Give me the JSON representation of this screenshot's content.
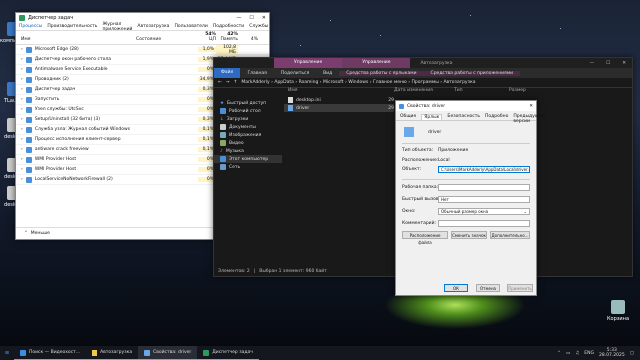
{
  "desktop": {
    "icons": [
      {
        "label": "Корзина"
      },
      {
        "label": "desktop"
      },
      {
        "label": "desktop"
      },
      {
        "label": "desktop"
      },
      {
        "label": "компьютер"
      },
      {
        "label": "TLaun..."
      }
    ]
  },
  "task_manager": {
    "title": "Диспетчер задач",
    "menu": [
      "Процессы",
      "Производительность",
      "Журнал приложений",
      "Автозагрузка",
      "Пользователи",
      "Подробности",
      "Службы"
    ],
    "headers": {
      "name": "Имя",
      "status": "Состояние",
      "cpu_pct": "54%",
      "cpu": "ЦП",
      "mem_pct": "42%",
      "mem": "Память",
      "disk_pct": "4%"
    },
    "rows": [
      {
        "name": "Microsoft Edge (28)",
        "cpu": "1,0%",
        "mem": "102,8 МБ"
      },
      {
        "name": "Диспетчер окон рабочего стола",
        "cpu": "1,9%",
        "mem": "57,4 МБ"
      },
      {
        "name": "Antimalware Service Executable",
        "cpu": "0%",
        "mem": "34,3 МБ"
      },
      {
        "name": "Проводник (2)",
        "cpu": "34,9%",
        "mem": "29,6 МБ"
      },
      {
        "name": "Диспетчер задач",
        "cpu": "0,3%",
        "mem": "27,6 МБ"
      },
      {
        "name": "Запустить",
        "cpu": "0%",
        "mem": "24,5 МБ"
      },
      {
        "name": "Узел службы: UtcSvc",
        "cpu": "0%",
        "mem": "17,1 МБ"
      },
      {
        "name": "Setup/Uninstall (32 бита) (3)",
        "cpu": "0,3%",
        "mem": "15,5 МБ"
      },
      {
        "name": "Служба узла: Журнал событий Windows",
        "cpu": "0,1%",
        "mem": "14,6 МБ"
      },
      {
        "name": "Процесс исполнения клиент-сервер",
        "cpu": "0,1%",
        "mem": "12,6 МБ"
      },
      {
        "name": "antiware crack freeview",
        "cpu": "0,1%",
        "mem": "11,3 МБ"
      },
      {
        "name": "WMI Provider Host",
        "cpu": "0%",
        "mem": "9,0 МБ"
      },
      {
        "name": "WMI Provider Host",
        "cpu": "0%",
        "mem": "8,3 МБ"
      },
      {
        "name": "LocalServiceNoNetworkFirewall (2)",
        "cpu": "0%",
        "mem": "7,8 МБ"
      }
    ],
    "footer": "Меньше"
  },
  "explorer": {
    "tabs": [
      "Управление",
      "Управление",
      "Автозагрузка"
    ],
    "ribbon": [
      "Файл",
      "Главная",
      "Поделиться",
      "Вид",
      "Средства работы с ярлыками",
      "Средства работы с приложениями"
    ],
    "path": [
      "MarkAdderly",
      "AppData",
      "Roaming",
      "Microsoft",
      "Windows",
      "Главное меню",
      "Программы",
      "Автозагрузка"
    ],
    "columns": {
      "name": "Имя",
      "date": "Дата изменения",
      "type": "Тип",
      "size": "Размер"
    },
    "nav": [
      "Быстрый доступ",
      "Рабочий стол",
      "Загрузки",
      "Документы",
      "Изображения",
      "Видео",
      "Музыка",
      "Этот компьютер",
      "Сеть"
    ],
    "files": [
      {
        "name": "desktop.ini",
        "date": "29"
      },
      {
        "name": "driver",
        "date": "29"
      }
    ],
    "status": {
      "count": "Элементов: 2",
      "selected": "Выбран 1 элемент: 960 байт"
    }
  },
  "dialog": {
    "title": "Свойства: driver",
    "tabs": [
      "Общие",
      "Ярлык",
      "Безопасность",
      "Подробно",
      "Предыдущие версии"
    ],
    "name": "driver",
    "target_type_label": "Тип объекта:",
    "target_type": "Приложение",
    "location_label": "Расположение:",
    "location": "Local",
    "target_label": "Объект:",
    "target": "C:\\Users\\MarkAdderly\\AppData\\Local\\driver.exe",
    "workdir_label": "Рабочая папка:",
    "hotkey_label": "Быстрый вызов:",
    "hotkey": "Нет",
    "window_label": "Окно:",
    "window": "Обычный размер окна",
    "comment_label": "Комментарий:",
    "btn_location": "Расположение файла",
    "btn_icon": "Сменить значок",
    "btn_advanced": "Дополнительно...",
    "ok": "ОК",
    "cancel": "Отмена",
    "apply": "Применить"
  },
  "taskbar": {
    "items": [
      "Поиск — Видеохост...",
      "Автозагрузка",
      "Свойства: driver",
      "Диспетчер задач"
    ],
    "lang": "ENG",
    "time": "5:33",
    "date": "28.07.2025"
  }
}
